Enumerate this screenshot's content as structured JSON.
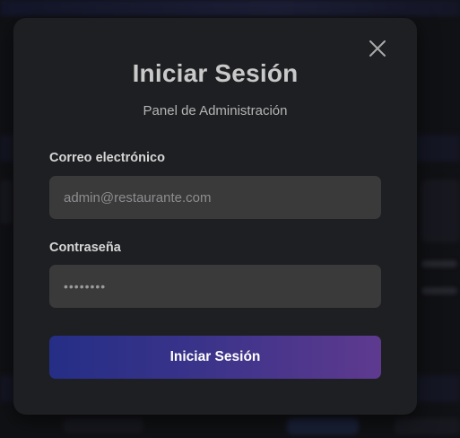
{
  "modal": {
    "title": "Iniciar Sesión",
    "subtitle": "Panel de Administración",
    "email": {
      "label": "Correo electrónico",
      "placeholder": "admin@restaurante.com",
      "value": ""
    },
    "password": {
      "label": "Contraseña",
      "value": "••••••••"
    },
    "submit_label": "Iniciar Sesión",
    "close_icon": "close-icon"
  },
  "colors": {
    "modal_bg": "#1e1f22",
    "field_bg": "#3a3a3b",
    "button_gradient_start": "#252e86",
    "button_gradient_end": "#5e3a8f"
  }
}
